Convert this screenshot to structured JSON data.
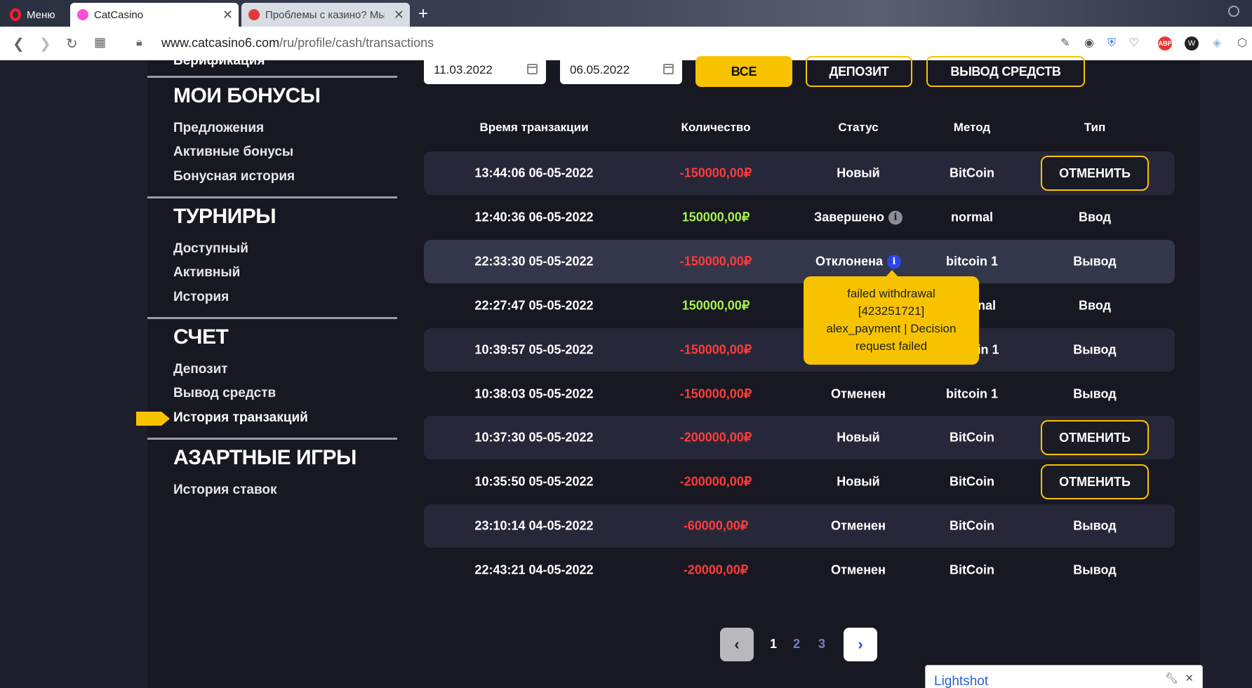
{
  "browser": {
    "menu_label": "Меню",
    "tabs": [
      {
        "title": "CatCasino"
      },
      {
        "title": "Проблемы с казино? Мы"
      }
    ],
    "url_host": "www.catcasino6.com",
    "url_path": "/ru/profile/cash/transactions"
  },
  "sidebar": {
    "cut_item": "Верификация",
    "sections": [
      {
        "title": "МОИ БОНУСЫ",
        "items": [
          "Предложения",
          "Активные бонусы",
          "Бонусная история"
        ]
      },
      {
        "title": "ТУРНИРЫ",
        "items": [
          "Доступный",
          "Активный",
          "История"
        ]
      },
      {
        "title": "СЧЕТ",
        "items": [
          "Депозит",
          "Вывод средств",
          "История транзакций"
        ]
      },
      {
        "title": "АЗАРТНЫЕ ИГРЫ",
        "items": [
          "История ставок"
        ]
      }
    ],
    "active_item": "История транзакций"
  },
  "filters": {
    "date_from": "11.03.2022",
    "date_to": "06.05.2022",
    "btn_all": "ВСЕ",
    "btn_deposit": "ДЕПОЗИТ",
    "btn_withdraw": "ВЫВОД СРЕДСТВ"
  },
  "table": {
    "headers": [
      "Время транзакции",
      "Количество",
      "Статус",
      "Метод",
      "Тип"
    ],
    "rows": [
      {
        "time": "13:44:06 06-05-2022",
        "amount": "-150000,00₽",
        "status": "Новый",
        "method": "BitCoin",
        "type": "ОТМЕНИТЬ"
      },
      {
        "time": "12:40:36 06-05-2022",
        "amount": "150000,00₽",
        "status": "Завершено",
        "method": "normal",
        "type": "Ввод"
      },
      {
        "time": "22:33:30 05-05-2022",
        "amount": "-150000,00₽",
        "status": "Отклонена",
        "method": "bitcoin 1",
        "type": "Вывод"
      },
      {
        "time": "22:27:47 05-05-2022",
        "amount": "150000,00₽",
        "status": "",
        "method": "nal",
        "type": "Ввод"
      },
      {
        "time": "10:39:57 05-05-2022",
        "amount": "-150000,00₽",
        "status": "",
        "method": "in 1",
        "type": "Вывод"
      },
      {
        "time": "10:38:03 05-05-2022",
        "amount": "-150000,00₽",
        "status": "Отменен",
        "method": "bitcoin 1",
        "type": "Вывод"
      },
      {
        "time": "10:37:30 05-05-2022",
        "amount": "-200000,00₽",
        "status": "Новый",
        "method": "BitCoin",
        "type": "ОТМЕНИТЬ"
      },
      {
        "time": "10:35:50 05-05-2022",
        "amount": "-200000,00₽",
        "status": "Новый",
        "method": "BitCoin",
        "type": "ОТМЕНИТЬ"
      },
      {
        "time": "23:10:14 04-05-2022",
        "amount": "-60000,00₽",
        "status": "Отменен",
        "method": "BitCoin",
        "type": "Вывод"
      },
      {
        "time": "22:43:21 04-05-2022",
        "amount": "-20000,00₽",
        "status": "Отменен",
        "method": "BitCoin",
        "type": "Вывод"
      }
    ]
  },
  "tooltip": {
    "line1": "failed withdrawal",
    "line2": "[423251721]",
    "line3": "alex_payment | Decision",
    "line4": "request failed"
  },
  "pagination": {
    "pages": [
      "1",
      "2",
      "3"
    ],
    "current": "1"
  },
  "lightshot": {
    "title": "Lightshot"
  },
  "colors": {
    "accent": "#f7c300",
    "negative": "#ff3b3b",
    "positive": "#a6f050",
    "background": "#1d1f2c"
  }
}
